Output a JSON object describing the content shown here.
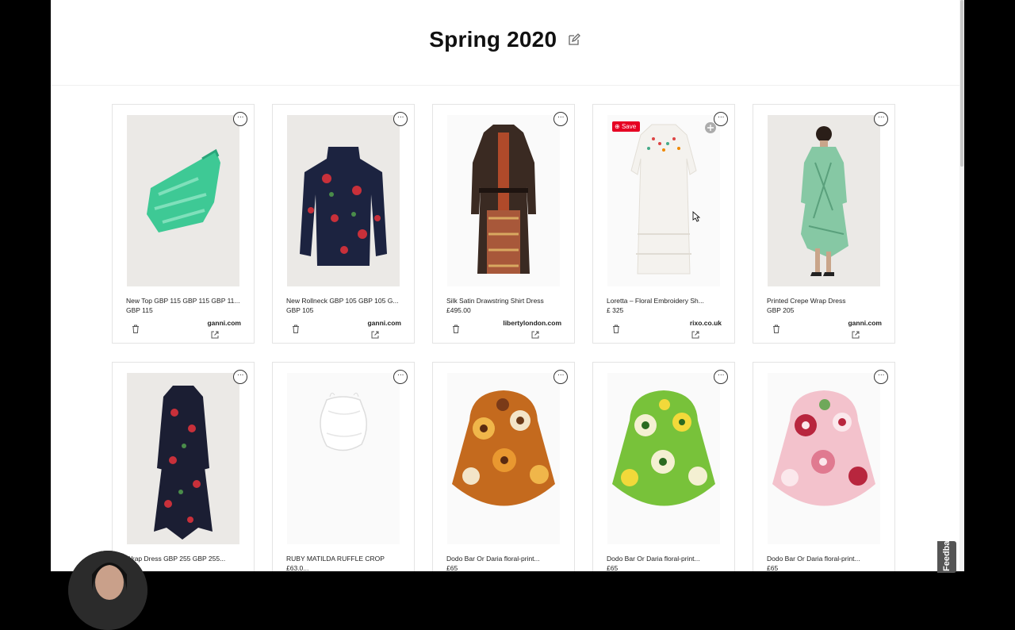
{
  "board": {
    "title": "Spring 2020"
  },
  "save_badge": "Save",
  "feedback_label": "Feedback",
  "products": [
    {
      "name": "New Top GBP 115 GBP 115 GBP 11...",
      "price": "GBP 115",
      "store": "ganni.com"
    },
    {
      "name": "New Rollneck GBP 105 GBP 105 G...",
      "price": "GBP 105",
      "store": "ganni.com"
    },
    {
      "name": "Silk Satin Drawstring Shirt Dress",
      "price": "£495.00",
      "store": "libertylondon.com"
    },
    {
      "name": "Loretta – Floral Embroidery Sh...",
      "price": "£ 325",
      "store": "rixo.co.uk"
    },
    {
      "name": "Printed Crepe Wrap Dress",
      "price": "GBP 205",
      "store": "ganni.com"
    },
    {
      "name": "Wrap Dress GBP 255 GBP 255...",
      "price": "",
      "store": ""
    },
    {
      "name": "RUBY MATILDA RUFFLE CROP",
      "price": "£63.0...",
      "store": ""
    },
    {
      "name": "Dodo Bar Or Daria floral-print...",
      "price": "£65",
      "store": ""
    },
    {
      "name": "Dodo Bar Or Daria floral-print...",
      "price": "£65",
      "store": ""
    },
    {
      "name": "Dodo Bar Or Daria floral-print...",
      "price": "£65",
      "store": ""
    }
  ]
}
